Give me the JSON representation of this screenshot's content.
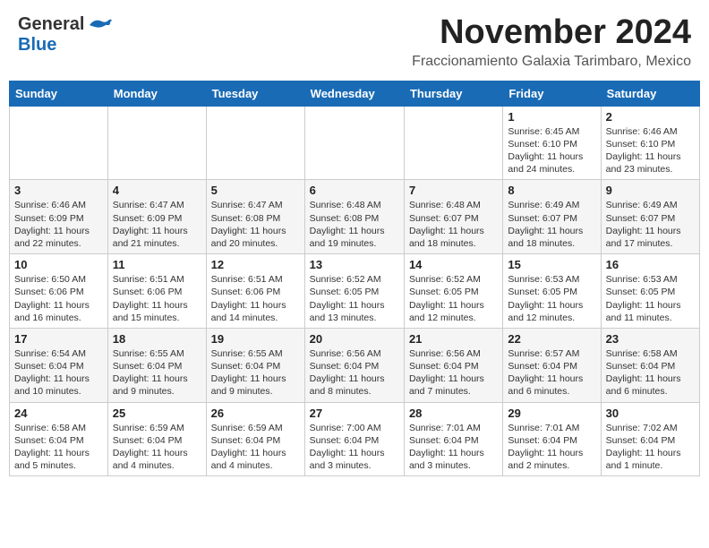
{
  "header": {
    "logo_general": "General",
    "logo_blue": "Blue",
    "month_year": "November 2024",
    "location": "Fraccionamiento Galaxia Tarimbaro, Mexico"
  },
  "days_of_week": [
    "Sunday",
    "Monday",
    "Tuesday",
    "Wednesday",
    "Thursday",
    "Friday",
    "Saturday"
  ],
  "weeks": [
    [
      {
        "day": "",
        "info": ""
      },
      {
        "day": "",
        "info": ""
      },
      {
        "day": "",
        "info": ""
      },
      {
        "day": "",
        "info": ""
      },
      {
        "day": "",
        "info": ""
      },
      {
        "day": "1",
        "info": "Sunrise: 6:45 AM\nSunset: 6:10 PM\nDaylight: 11 hours and 24 minutes."
      },
      {
        "day": "2",
        "info": "Sunrise: 6:46 AM\nSunset: 6:10 PM\nDaylight: 11 hours and 23 minutes."
      }
    ],
    [
      {
        "day": "3",
        "info": "Sunrise: 6:46 AM\nSunset: 6:09 PM\nDaylight: 11 hours and 22 minutes."
      },
      {
        "day": "4",
        "info": "Sunrise: 6:47 AM\nSunset: 6:09 PM\nDaylight: 11 hours and 21 minutes."
      },
      {
        "day": "5",
        "info": "Sunrise: 6:47 AM\nSunset: 6:08 PM\nDaylight: 11 hours and 20 minutes."
      },
      {
        "day": "6",
        "info": "Sunrise: 6:48 AM\nSunset: 6:08 PM\nDaylight: 11 hours and 19 minutes."
      },
      {
        "day": "7",
        "info": "Sunrise: 6:48 AM\nSunset: 6:07 PM\nDaylight: 11 hours and 18 minutes."
      },
      {
        "day": "8",
        "info": "Sunrise: 6:49 AM\nSunset: 6:07 PM\nDaylight: 11 hours and 18 minutes."
      },
      {
        "day": "9",
        "info": "Sunrise: 6:49 AM\nSunset: 6:07 PM\nDaylight: 11 hours and 17 minutes."
      }
    ],
    [
      {
        "day": "10",
        "info": "Sunrise: 6:50 AM\nSunset: 6:06 PM\nDaylight: 11 hours and 16 minutes."
      },
      {
        "day": "11",
        "info": "Sunrise: 6:51 AM\nSunset: 6:06 PM\nDaylight: 11 hours and 15 minutes."
      },
      {
        "day": "12",
        "info": "Sunrise: 6:51 AM\nSunset: 6:06 PM\nDaylight: 11 hours and 14 minutes."
      },
      {
        "day": "13",
        "info": "Sunrise: 6:52 AM\nSunset: 6:05 PM\nDaylight: 11 hours and 13 minutes."
      },
      {
        "day": "14",
        "info": "Sunrise: 6:52 AM\nSunset: 6:05 PM\nDaylight: 11 hours and 12 minutes."
      },
      {
        "day": "15",
        "info": "Sunrise: 6:53 AM\nSunset: 6:05 PM\nDaylight: 11 hours and 12 minutes."
      },
      {
        "day": "16",
        "info": "Sunrise: 6:53 AM\nSunset: 6:05 PM\nDaylight: 11 hours and 11 minutes."
      }
    ],
    [
      {
        "day": "17",
        "info": "Sunrise: 6:54 AM\nSunset: 6:04 PM\nDaylight: 11 hours and 10 minutes."
      },
      {
        "day": "18",
        "info": "Sunrise: 6:55 AM\nSunset: 6:04 PM\nDaylight: 11 hours and 9 minutes."
      },
      {
        "day": "19",
        "info": "Sunrise: 6:55 AM\nSunset: 6:04 PM\nDaylight: 11 hours and 9 minutes."
      },
      {
        "day": "20",
        "info": "Sunrise: 6:56 AM\nSunset: 6:04 PM\nDaylight: 11 hours and 8 minutes."
      },
      {
        "day": "21",
        "info": "Sunrise: 6:56 AM\nSunset: 6:04 PM\nDaylight: 11 hours and 7 minutes."
      },
      {
        "day": "22",
        "info": "Sunrise: 6:57 AM\nSunset: 6:04 PM\nDaylight: 11 hours and 6 minutes."
      },
      {
        "day": "23",
        "info": "Sunrise: 6:58 AM\nSunset: 6:04 PM\nDaylight: 11 hours and 6 minutes."
      }
    ],
    [
      {
        "day": "24",
        "info": "Sunrise: 6:58 AM\nSunset: 6:04 PM\nDaylight: 11 hours and 5 minutes."
      },
      {
        "day": "25",
        "info": "Sunrise: 6:59 AM\nSunset: 6:04 PM\nDaylight: 11 hours and 4 minutes."
      },
      {
        "day": "26",
        "info": "Sunrise: 6:59 AM\nSunset: 6:04 PM\nDaylight: 11 hours and 4 minutes."
      },
      {
        "day": "27",
        "info": "Sunrise: 7:00 AM\nSunset: 6:04 PM\nDaylight: 11 hours and 3 minutes."
      },
      {
        "day": "28",
        "info": "Sunrise: 7:01 AM\nSunset: 6:04 PM\nDaylight: 11 hours and 3 minutes."
      },
      {
        "day": "29",
        "info": "Sunrise: 7:01 AM\nSunset: 6:04 PM\nDaylight: 11 hours and 2 minutes."
      },
      {
        "day": "30",
        "info": "Sunrise: 7:02 AM\nSunset: 6:04 PM\nDaylight: 11 hours and 1 minute."
      }
    ]
  ]
}
